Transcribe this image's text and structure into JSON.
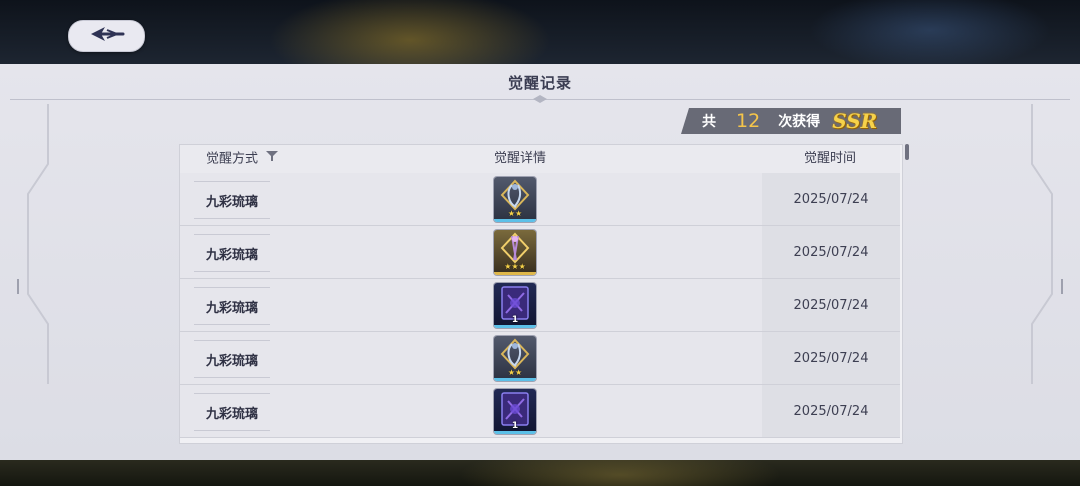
{
  "back_button": {
    "icon": "back-arrow-icon"
  },
  "panel": {
    "title": "觉醒记录"
  },
  "summary": {
    "prefix": "共",
    "count": "12",
    "suffix": "次获得",
    "rank": "SSR"
  },
  "table": {
    "headers": {
      "method": "觉醒方式",
      "detail": "觉醒详情",
      "time": "觉醒时间"
    },
    "filter_icon": "filter-funnel-icon",
    "rows": [
      {
        "method": "九彩琉璃",
        "item": {
          "icon": "silver-hairpin-icon",
          "frame": "silver",
          "stars": "★★"
        },
        "time": "2025/07/24"
      },
      {
        "method": "九彩琉璃",
        "item": {
          "icon": "gold-hairpin-icon",
          "frame": "gold",
          "stars": "★★★"
        },
        "time": "2025/07/24"
      },
      {
        "method": "九彩琉璃",
        "item": {
          "icon": "purple-card-icon",
          "frame": "card",
          "qty": "1"
        },
        "time": "2025/07/24"
      },
      {
        "method": "九彩琉璃",
        "item": {
          "icon": "silver-hairpin-icon",
          "frame": "silver",
          "stars": "★★"
        },
        "time": "2025/07/24"
      },
      {
        "method": "九彩琉璃",
        "item": {
          "icon": "purple-card-icon",
          "frame": "card",
          "qty": "1"
        },
        "time": "2025/07/24"
      }
    ]
  },
  "colors": {
    "accent_gold": "#f5c54a",
    "badge_bg": "#686a76",
    "panel_bg": "#e5e5ec"
  }
}
